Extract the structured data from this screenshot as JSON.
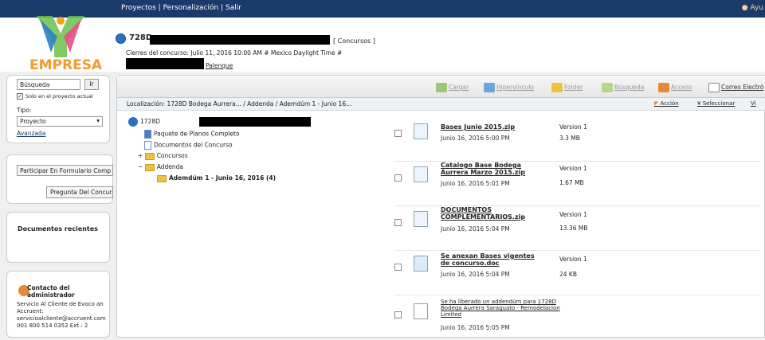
{
  "topbar": {
    "nav": "Proyectos | Personalización | Salir",
    "help": "Ayu"
  },
  "header": {
    "logo_text": "EMPRESA",
    "project_code": "728D",
    "concursos_link": "[ Concursos ]",
    "cierres": "Cierres del concurso: Julio 11, 2016 10:00 AM # Mexico Daylight Time #",
    "palenque": "Palenque"
  },
  "sidebar": {
    "search_value": "Búsqueda",
    "search_button": "Ir",
    "only_project_label": "Solo en el proyecto actual",
    "tipo_label": "Tipo:",
    "tipo_value": "Proyecto",
    "avanzada": "Avanzada",
    "participar_button": "Participar En Formulario Comp",
    "pregunta_button": "Pregunta Del Concur",
    "recent_title": "Documentos recientes",
    "contact_title": "Contacto del administrador",
    "contact_body": "Servicio Al Cliente de Evoco an Accruent: servicioalcliente@accruent.com 001 800 514 0352 Ext.: 2"
  },
  "toolbar": {
    "cargar": "Cargar",
    "hipervinculo": "Hipervínculo",
    "folder": "Folder",
    "busqueda": "Búsqueda",
    "acceso": "Acceso",
    "correo": "Correo Electró"
  },
  "locbar": {
    "location": "Localización:  1728D Bodega Aurrera... / Addenda / Ademdúm 1 - Junio 16...",
    "accion": "Acción",
    "seleccionar": "Seleccionar",
    "ver": "Vi"
  },
  "tree": [
    {
      "label": "1728D",
      "indent": 0,
      "icon": "home"
    },
    {
      "label": "Paquete de Planos Completo",
      "indent": 1,
      "icon": "pkg"
    },
    {
      "label": "Documentos del Concurso",
      "indent": 1,
      "icon": "doc"
    },
    {
      "label": "Concursos",
      "indent": 1,
      "icon": "folder"
    },
    {
      "label": "Addenda",
      "indent": 1,
      "icon": "folder"
    },
    {
      "label": "Ademdúm 1 - Junio 16, 2016 (4)",
      "indent": 2,
      "icon": "folder"
    }
  ],
  "files": [
    {
      "name": "Bases Junio 2015.zip",
      "date": "Junio 16, 2016 5:00 PM",
      "version": "Version 1",
      "size": "3.3 MB"
    },
    {
      "name": "Catalogo Base Bodega Aurrera Marzo 2015.zip",
      "date": "Junio 16, 2016 5:01 PM",
      "version": "Version 1",
      "size": "1.67 MB"
    },
    {
      "name": "DOCUMENTOS COMPLEMENTARIOS.zip",
      "date": "Junio 16, 2016 5:04 PM",
      "version": "Version 1",
      "size": "13.36 MB"
    },
    {
      "name": "Se anexan Bases vigentes de concurso.doc",
      "date": "Junio 16, 2016 5:04 PM",
      "version": "Version 1",
      "size": "24 KB"
    },
    {
      "name": "Se ha liberado un addendúm para 1728D Bodega Aurrera Saraguato - Remodelacion Limited",
      "date": "Junio 16, 2016 5:05 PM",
      "version": "",
      "size": ""
    }
  ]
}
